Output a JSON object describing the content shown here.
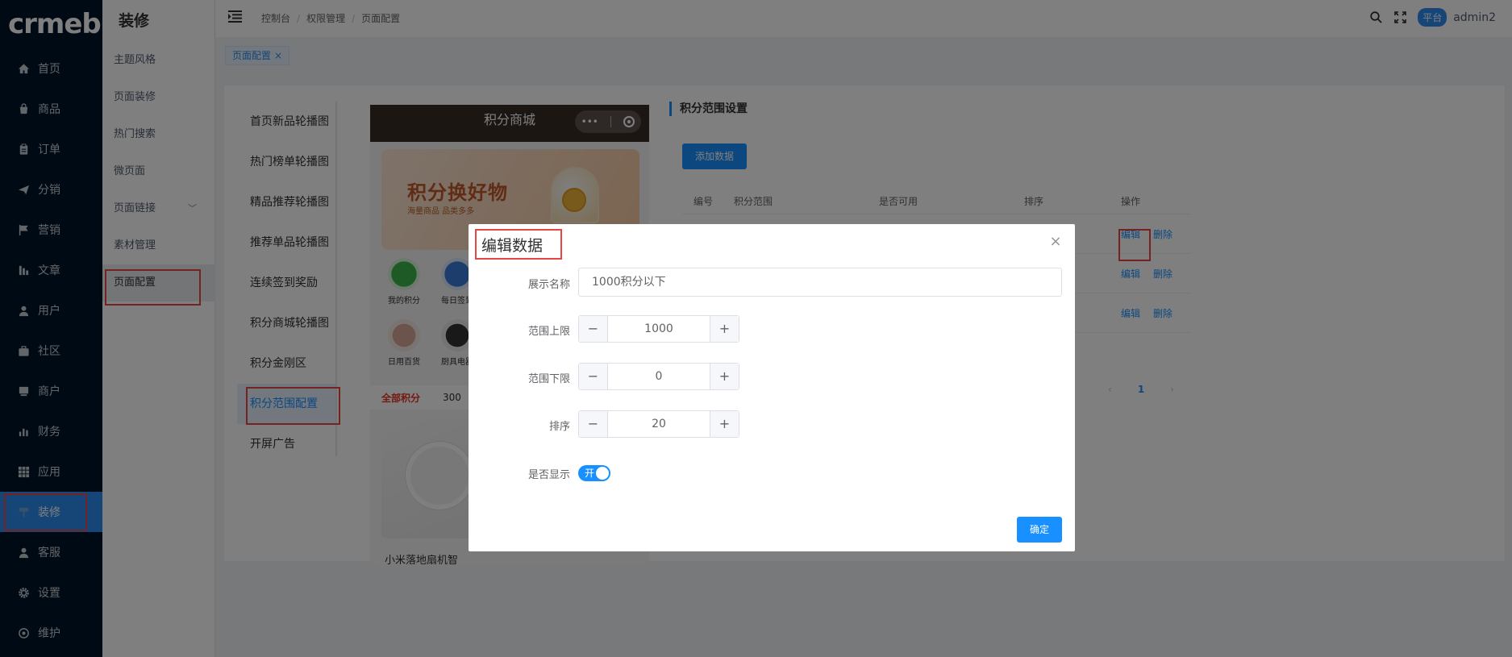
{
  "app": {
    "logo_text": "crmeb",
    "logo_reg": "®"
  },
  "sidebar": {
    "items": [
      {
        "label": "首页",
        "icon": "home-icon"
      },
      {
        "label": "商品",
        "icon": "shopping-bag-icon"
      },
      {
        "label": "订单",
        "icon": "clipboard-icon"
      },
      {
        "label": "分销",
        "icon": "paper-plane-icon"
      },
      {
        "label": "营销",
        "icon": "flag-icon"
      },
      {
        "label": "文章",
        "icon": "bar-chart-icon"
      },
      {
        "label": "用户",
        "icon": "user-icon"
      },
      {
        "label": "社区",
        "icon": "briefcase-icon"
      },
      {
        "label": "商户",
        "icon": "store-icon"
      },
      {
        "label": "财务",
        "icon": "stats-icon"
      },
      {
        "label": "应用",
        "icon": "grid-icon"
      },
      {
        "label": "装修",
        "icon": "paint-roller-icon"
      },
      {
        "label": "客服",
        "icon": "headset-user-icon"
      },
      {
        "label": "设置",
        "icon": "gear-icon"
      },
      {
        "label": "维护",
        "icon": "wrench-icon"
      }
    ],
    "active_index": 11
  },
  "subnav": {
    "title": "装修",
    "items": [
      {
        "label": "主题风格"
      },
      {
        "label": "页面装修"
      },
      {
        "label": "热门搜索"
      },
      {
        "label": "微页面"
      },
      {
        "label": "页面链接"
      },
      {
        "label": "素材管理"
      },
      {
        "label": "页面配置"
      }
    ]
  },
  "header": {
    "breadcrumb": [
      "控制台",
      "权限管理",
      "页面配置"
    ],
    "badge": "平台",
    "username": "admin2"
  },
  "tabs": [
    {
      "label": "页面配置",
      "close": "×"
    }
  ],
  "config_menu": {
    "items": [
      "首页新品轮播图",
      "热门榜单轮播图",
      "精品推荐轮播图",
      "推荐单品轮播图",
      "连续签到奖励",
      "积分商城轮播图",
      "积分金刚区",
      "积分范围配置",
      "开屏广告"
    ],
    "active_index": 7
  },
  "phone": {
    "title": "积分商城",
    "caps_dots": "•••",
    "banner_big": "积分换好物",
    "banner_small": "海量商品  品类多多",
    "icons": [
      "我的积分",
      "每日签到",
      "日用百货",
      "厨具电器"
    ],
    "sub_label": "全部积分",
    "sub_value": "300",
    "product_name": "小米落地扇机智"
  },
  "panel": {
    "title": "积分范围设置",
    "add_button": "添加数据",
    "columns": [
      "编号",
      "积分范围",
      "是否可用",
      "排序",
      "操作"
    ],
    "rows": [
      {
        "edit": "编辑",
        "delete": "删除"
      },
      {
        "edit": "编辑",
        "delete": "删除"
      },
      {
        "edit": "编辑",
        "delete": "删除"
      }
    ],
    "pager": {
      "prev": "‹",
      "current": "1",
      "next": "›"
    }
  },
  "dialog": {
    "title": "编辑数据",
    "close": "×",
    "fields": {
      "name_label": "展示名称",
      "name_value": "1000积分以下",
      "upper_label": "范围上限",
      "upper_value": "1000",
      "lower_label": "范围下限",
      "lower_value": "0",
      "sort_label": "排序",
      "sort_value": "20",
      "show_label": "是否显示",
      "show_value": "开"
    },
    "minus": "−",
    "plus": "+",
    "confirm": "确定"
  },
  "colors": {
    "primary": "#1890ff",
    "sidebar_bg": "#001529",
    "highlight": "#e84545"
  }
}
